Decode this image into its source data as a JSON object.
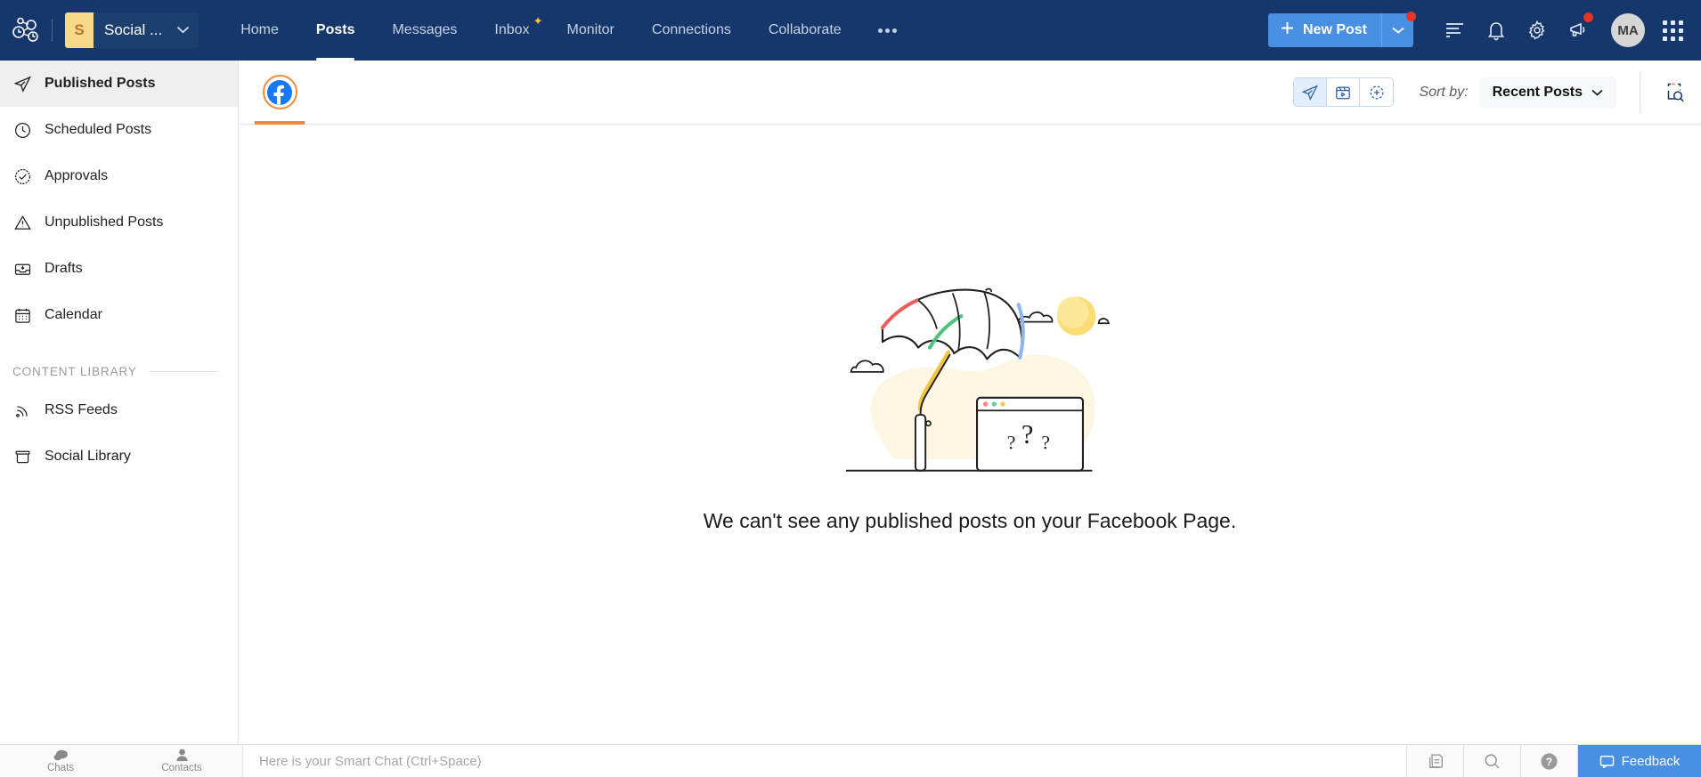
{
  "topbar": {
    "logo_icon": "zoho-social-logo-icon",
    "brand": {
      "badge": "S",
      "name": "Social ...",
      "caret_icon": "chevron-down-icon"
    },
    "nav": [
      {
        "label": "Home",
        "active": false,
        "sparkle": false
      },
      {
        "label": "Posts",
        "active": true,
        "sparkle": false
      },
      {
        "label": "Messages",
        "active": false,
        "sparkle": false
      },
      {
        "label": "Inbox",
        "active": false,
        "sparkle": true
      },
      {
        "label": "Monitor",
        "active": false,
        "sparkle": false
      },
      {
        "label": "Connections",
        "active": false,
        "sparkle": false
      },
      {
        "label": "Collaborate",
        "active": false,
        "sparkle": false
      }
    ],
    "more_label": "more-options-icon",
    "new_post": {
      "label": "New Post",
      "plus_icon": "plus-icon",
      "caret_icon": "chevron-down-icon",
      "has_badge": true
    },
    "icons": [
      {
        "name": "tasks-icon",
        "badge": false
      },
      {
        "name": "bell-icon",
        "badge": false
      },
      {
        "name": "gear-icon",
        "badge": false
      },
      {
        "name": "megaphone-icon",
        "badge": true
      }
    ],
    "avatar": "MA",
    "apps_icon": "apps-grid-icon",
    "colors": {
      "bar": "#16376b",
      "accent": "#4a90e2",
      "badge": "#e5352b"
    }
  },
  "sidebar": {
    "items": [
      {
        "label": "Published Posts",
        "icon": "paper-plane-icon",
        "active": true
      },
      {
        "label": "Scheduled Posts",
        "icon": "clock-icon",
        "active": false
      },
      {
        "label": "Approvals",
        "icon": "check-circle-icon",
        "active": false
      },
      {
        "label": "Unpublished Posts",
        "icon": "warning-triangle-icon",
        "active": false
      },
      {
        "label": "Drafts",
        "icon": "inbox-tray-icon",
        "active": false
      },
      {
        "label": "Calendar",
        "icon": "calendar-icon",
        "active": false
      }
    ],
    "section_label": "CONTENT LIBRARY",
    "library_items": [
      {
        "label": "RSS Feeds",
        "icon": "rss-icon"
      },
      {
        "label": "Social Library",
        "icon": "archive-box-icon"
      }
    ]
  },
  "main": {
    "channel_tab": {
      "name": "facebook-icon",
      "active": true,
      "ring_color": "#ef8b3f"
    },
    "view_toggle": [
      {
        "name": "posts-view-icon",
        "active": true
      },
      {
        "name": "reels-view-icon",
        "active": false
      },
      {
        "name": "stories-view-icon",
        "active": false
      }
    ],
    "sort": {
      "label": "Sort by:",
      "value": "Recent Posts",
      "caret_icon": "chevron-down-icon"
    },
    "audit_icon": "post-search-icon",
    "empty_state": {
      "message": "We can't see any published posts on your Facebook Page.",
      "illustration": "umbrella-browser-questions-illustration"
    }
  },
  "bottombar": {
    "tabs": [
      {
        "label": "Chats",
        "icon": "chat-bubbles-icon"
      },
      {
        "label": "Contacts",
        "icon": "person-icon"
      }
    ],
    "chat_placeholder": "Here is your Smart Chat (Ctrl+Space)",
    "right_icons": [
      {
        "name": "notes-icon"
      },
      {
        "name": "search-icon"
      },
      {
        "name": "help-icon"
      }
    ],
    "feedback": {
      "label": "Feedback",
      "icon": "feedback-chat-icon"
    }
  }
}
